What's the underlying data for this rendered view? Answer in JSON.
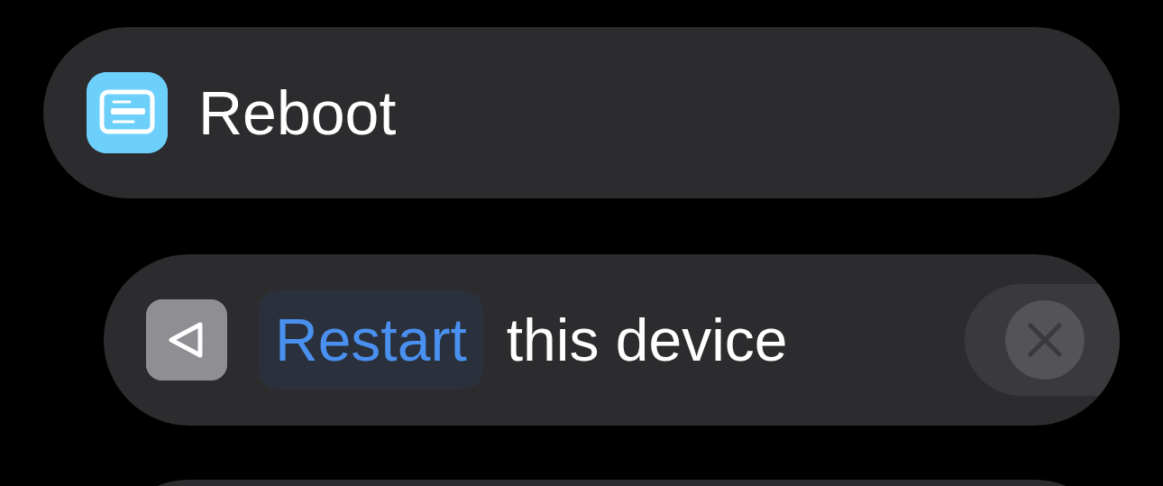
{
  "header": {
    "title": "Reboot"
  },
  "action": {
    "parameter": "Restart",
    "text": "this device"
  }
}
